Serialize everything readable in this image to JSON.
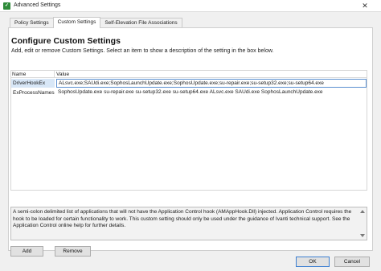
{
  "window": {
    "title": "Advanced Settings",
    "app_icon": "avanti-icon",
    "close_glyph": "✕"
  },
  "tabs": [
    {
      "label": "Policy Settings",
      "active": false
    },
    {
      "label": "Custom Settings",
      "active": true
    },
    {
      "label": "Self-Elevation File Associations",
      "active": false
    }
  ],
  "panel": {
    "heading": "Configure Custom Settings",
    "description": "Add, edit or remove Custom Settings. Select an item to show a description of the setting in the box below."
  },
  "grid": {
    "columns": [
      "Name",
      "Value"
    ],
    "rows": [
      {
        "name": "DriverHookEx",
        "value": "ALsvc.exe;SAUdi.exe;SophosLaunchUpdate.exe;SophosUpdate.exe;su-repair.exe;su-setup32.exe;su-setup64.exe",
        "selected": true
      },
      {
        "name": "ExProcessNames",
        "value": "SophosUpdate.exe su-repair.exe su-setup32.exe su-setup64.exe ALsvc.exe SAUdi.exe SophosLaunchUpdate.exe",
        "selected": false
      }
    ]
  },
  "description_box": {
    "text": "A semi-colon delimited list of applications that will not have the Application Control hook (AMAppHook.Dll) injected. Application Control requires the hook to be loaded for certain functionality to work. This custom setting should only be used under the guidance of Ivanti technical support. See the Application Control online help for further details."
  },
  "buttons": {
    "add": "Add",
    "remove": "Remove",
    "ok": "OK",
    "cancel": "Cancel"
  }
}
